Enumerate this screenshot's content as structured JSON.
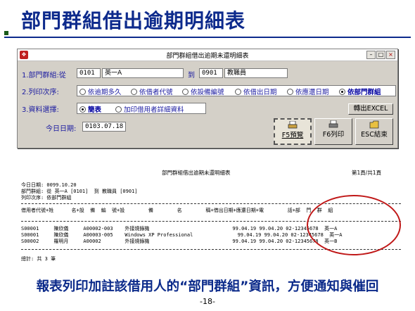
{
  "slide": {
    "title": "部門群組借出逾期明細表",
    "footnote": "報表列印加註該借用人的“部門群組”資訊，方便通知與催回",
    "page_number": "-18-"
  },
  "window": {
    "title": "部門群組借出逾期未還明細表",
    "min_icon": "–",
    "max_icon": "□",
    "close_icon": "×",
    "app_icon": "❖"
  },
  "form": {
    "dept_label": "1.部門群組:從",
    "dept_from_code": "0101",
    "dept_from_name": "英一A",
    "dept_to_label": "到",
    "dept_to_code": "0901",
    "dept_to_name": "教職員",
    "order_label": "2.列印次序:",
    "order_options": [
      "依逾期多久",
      "依借者代號",
      "依設備編號",
      "依借出日期",
      "依應還日期",
      "依部門群組"
    ],
    "order_selected": "依部門群組",
    "data_label": "3.資料選擇:",
    "data_options": [
      "簡表",
      "加印借用者詳細資料"
    ],
    "data_selected": "簡表",
    "today_label": "今日日期:",
    "today_value": "0103.07.18",
    "export_button": "轉出EXCEL",
    "preview_button": "F5預覽",
    "print_button": "F6列印",
    "close_button": "ESC結束"
  },
  "report": {
    "title": "部門群組借出逾期未還明細表",
    "page": "第1頁/共1頁",
    "today": "今日日期: 0099.10.20",
    "dept_range": "部門群組: 從 英一A [0101]  到 教職員 [0901]",
    "order": "列印次序: 依部門群組",
    "header": "借用者代號+姓      名+設  備  編  號+設        備        名        稱+借出日期+應還日期+電        話+部  門  群  組",
    "rows": [
      "S00001     陳欣儀     A00002-003    外接燒錄機                            99.04.19 99.04.20 02-12345678  英一A",
      "S00001     陳欣儀     A00003-005    Windows XP Professional               99.04.19 99.04.20 02-12345678  英一A",
      "S00002     羅明月     A00002        外接燒錄機                            99.04.19 99.04.20 02-12345678  英一B"
    ],
    "total": "總計: 共 3 筆"
  },
  "colors": {
    "title_blue": "#0d2a8c",
    "label_blue": "#1a1aa0",
    "highlight_red": "#c01818"
  }
}
